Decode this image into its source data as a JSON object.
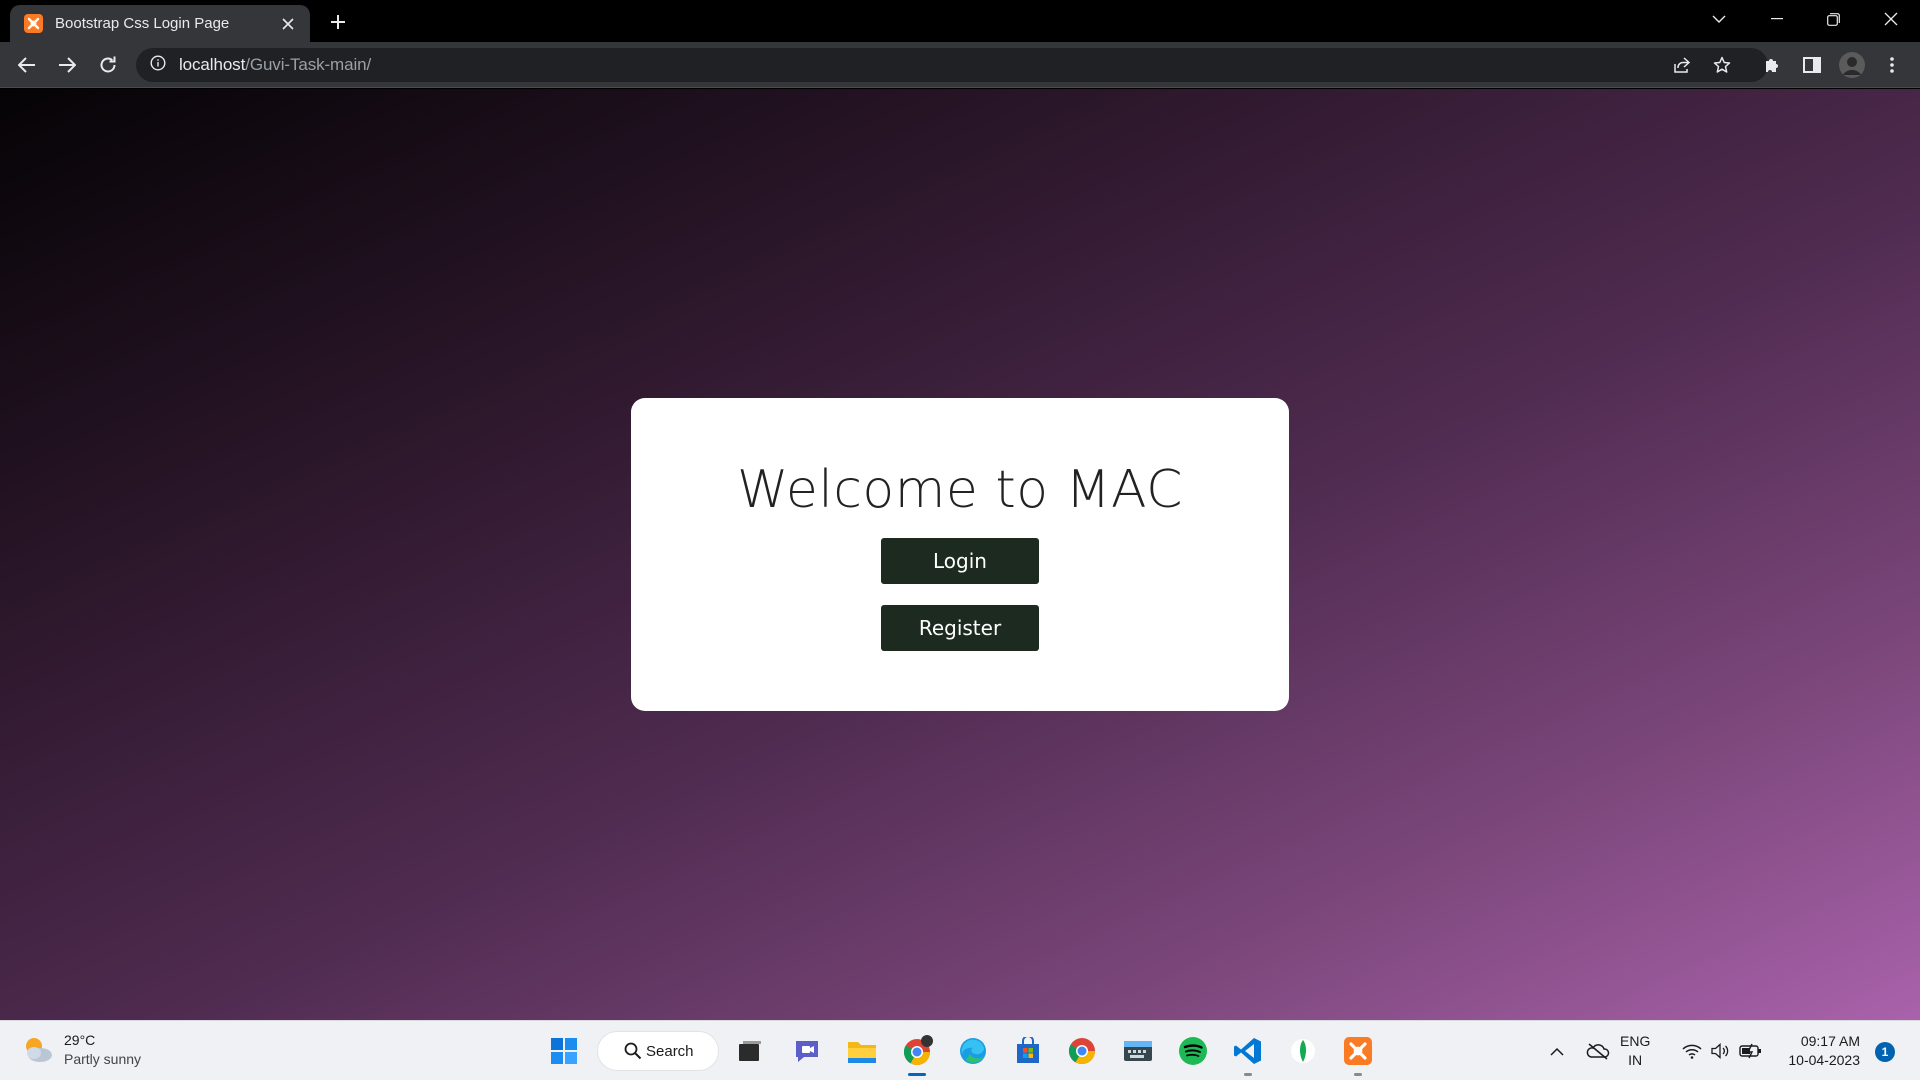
{
  "browser": {
    "tab": {
      "title": "Bootstrap Css Login Page",
      "favicon": "xampp-icon"
    },
    "address": {
      "host": "localhost",
      "path": "/Guvi-Task-main/"
    }
  },
  "page": {
    "welcome_text": "Welcome to MAC",
    "login_label": "Login",
    "register_label": "Register",
    "button_color": "#1c2a20"
  },
  "taskbar": {
    "weather": {
      "temp": "29°C",
      "desc": "Partly sunny"
    },
    "search_label": "Search",
    "lang_line1": "ENG",
    "lang_line2": "IN",
    "time": "09:17 AM",
    "date": "10-04-2023",
    "notification_count": "1"
  }
}
